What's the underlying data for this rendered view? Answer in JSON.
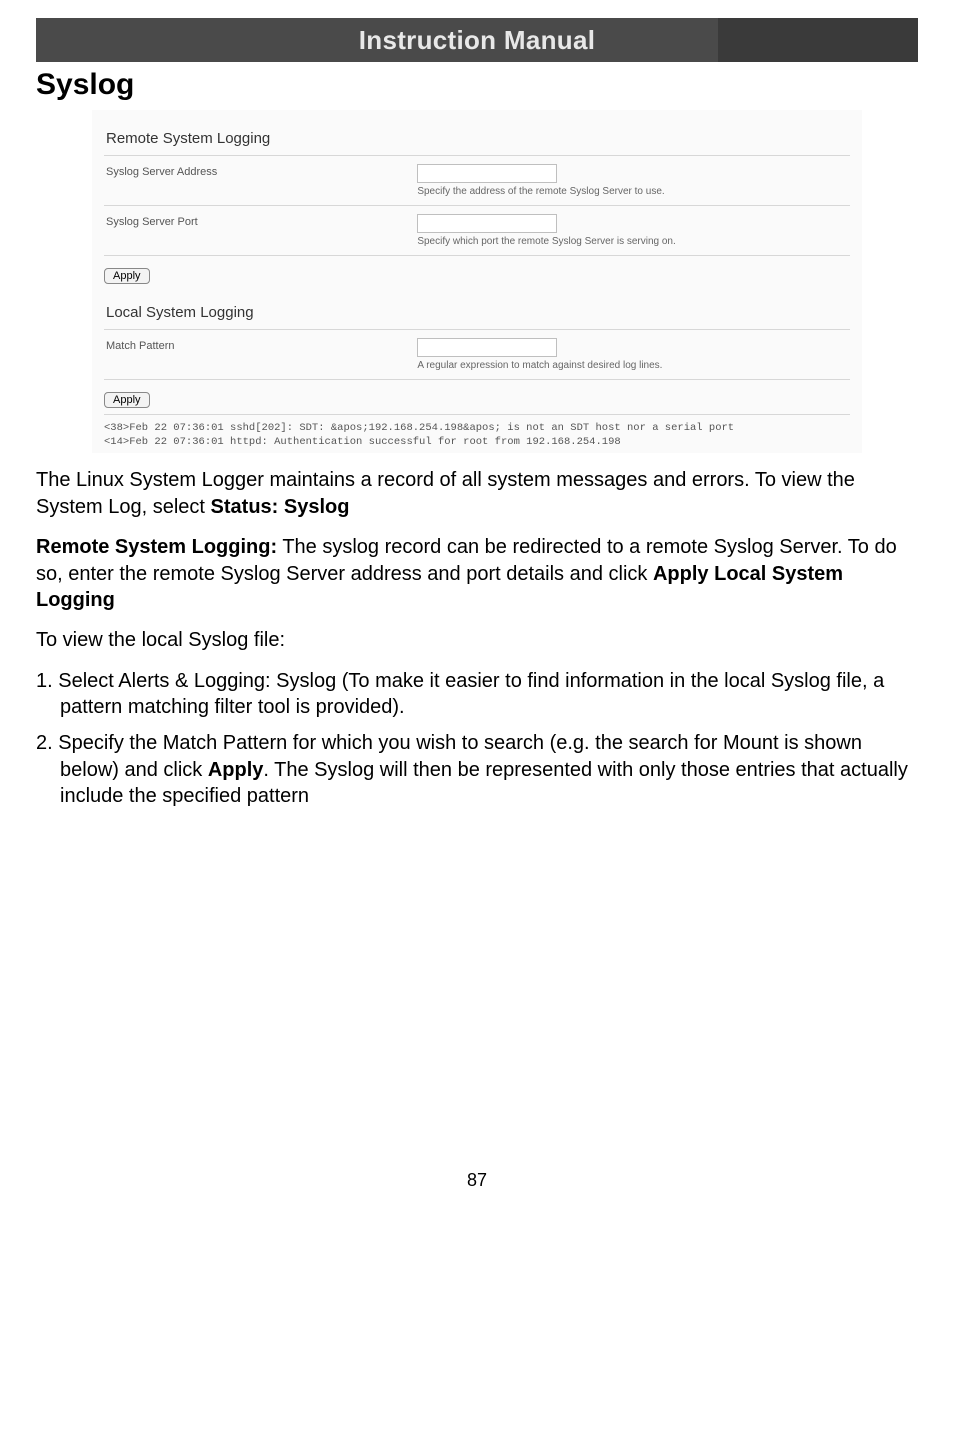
{
  "header": {
    "title": "Instruction Manual"
  },
  "page_title": "Syslog",
  "screenshot": {
    "remote": {
      "heading": "Remote System Logging",
      "rows": [
        {
          "label": "Syslog Server Address",
          "value": "",
          "hint": "Specify the address of the remote Syslog Server to use."
        },
        {
          "label": "Syslog Server Port",
          "value": "",
          "hint": "Specify which port the remote Syslog Server is serving on."
        }
      ],
      "apply": "Apply"
    },
    "local": {
      "heading": "Local System Logging",
      "rows": [
        {
          "label": "Match Pattern",
          "value": "",
          "hint": "A regular expression to match against desired log lines."
        }
      ],
      "apply": "Apply"
    },
    "log_lines": [
      "<38>Feb 22 07:36:01 sshd[202]: SDT: &apos;192.168.254.198&apos; is not an SDT host nor a serial port",
      "<14>Feb 22 07:36:01 httpd: Authentication successful for root from 192.168.254.198"
    ]
  },
  "content": {
    "p1_a": "The Linux System Logger maintains a record of all system messages and errors.  To view the System Log, select ",
    "p1_b": "Status: Syslog",
    "p2_a": "Remote System Logging:",
    "p2_b": " The syslog record can be redirected to a remote Syslog Server.  To do so, enter the remote Syslog Server address and port details and click ",
    "p2_c": "Apply Local System Logging",
    "p3": "To view the local Syslog file:",
    "steps": {
      "s1": "Select Alerts & Logging: Syslog (To make it easier to find information in the local Syslog file, a pattern matching filter tool is provided).",
      "s2_a": "Specify the Match Pattern for which you wish to search (e.g. the search for Mount is shown below) and click ",
      "s2_b": "Apply",
      "s2_c": ". The Syslog will then be represented with only those entries that actually include the specified pattern"
    }
  },
  "page_number": "87"
}
